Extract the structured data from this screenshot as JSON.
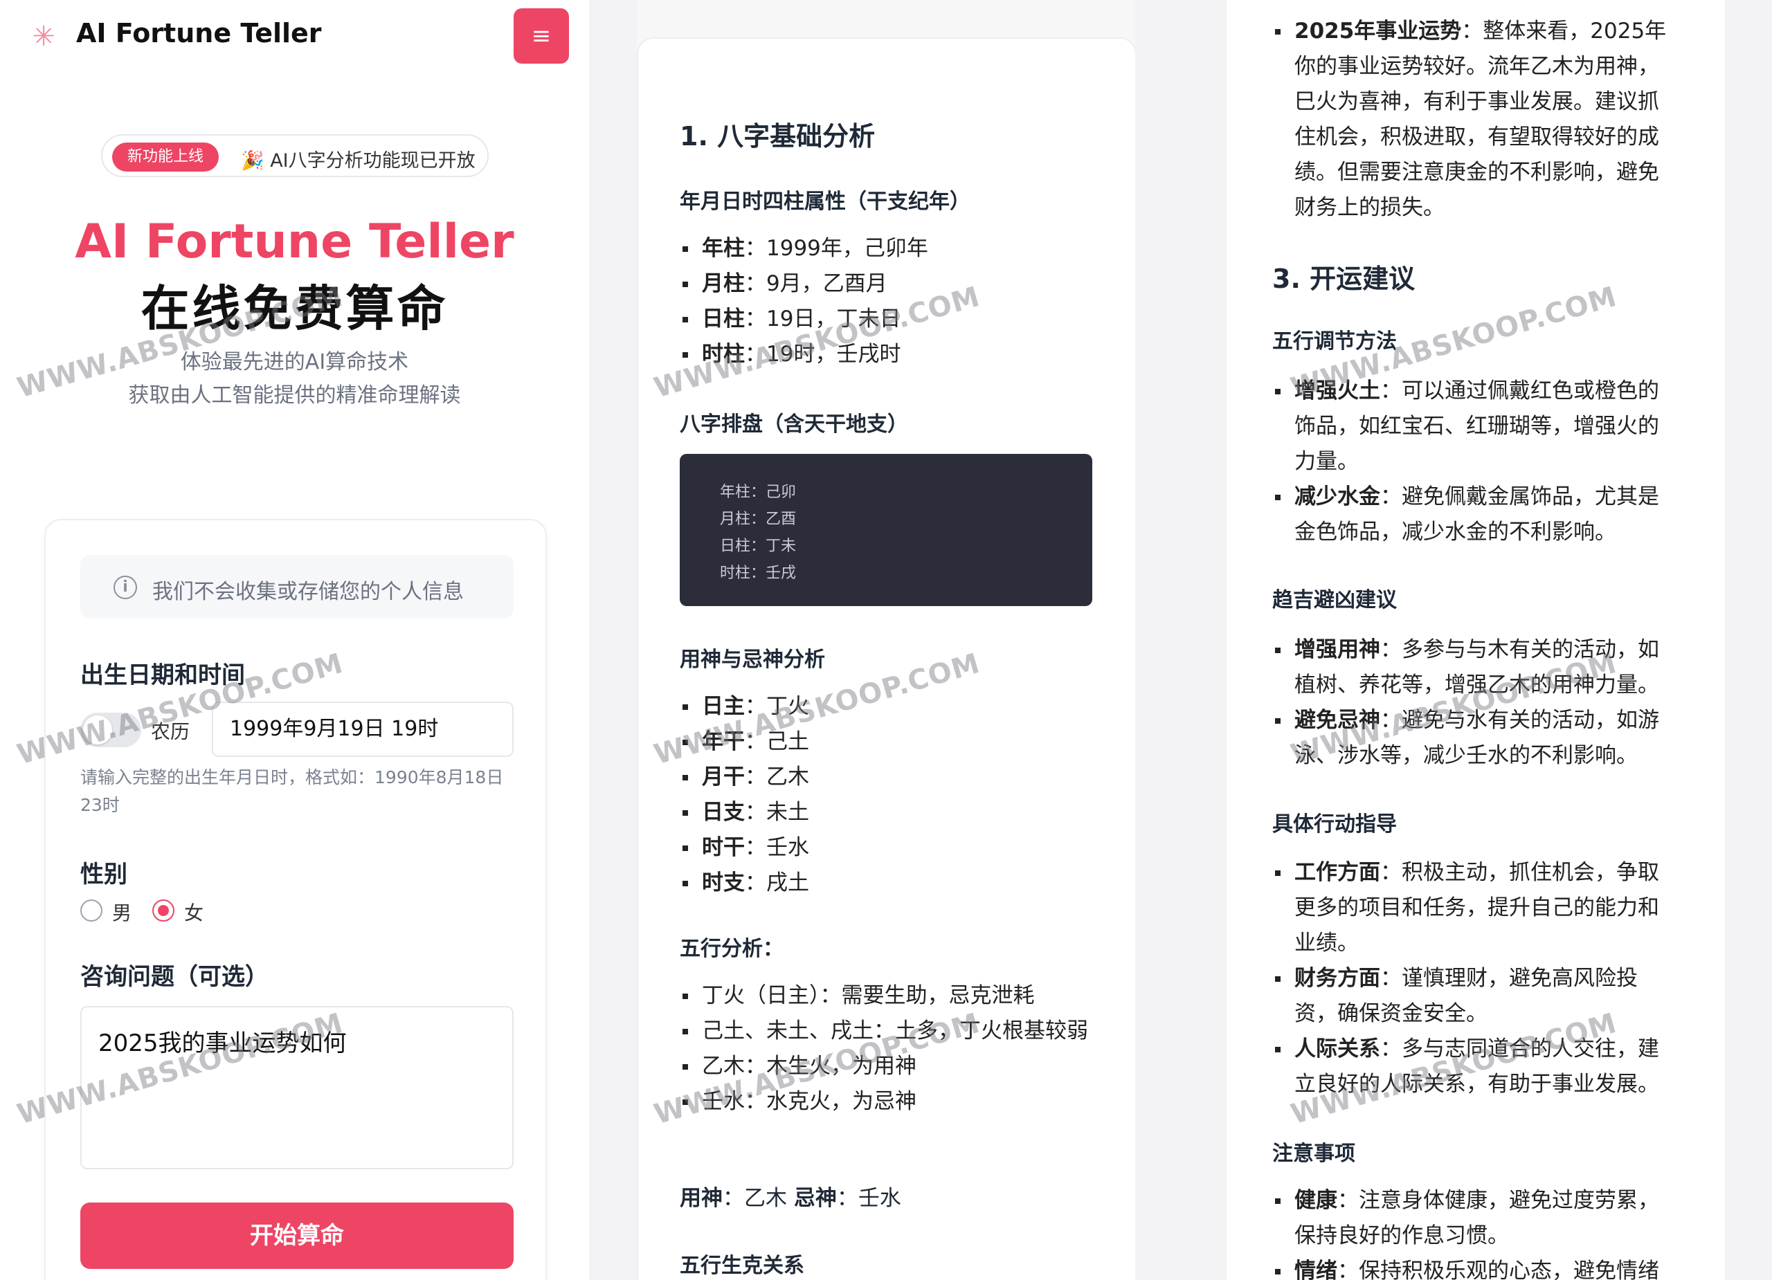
{
  "header": {
    "brand": "AI Fortune Teller",
    "menu_icon": "≡"
  },
  "announcement": {
    "badge": "新功能上线",
    "text": "🎉 AI八字分析功能现已开放"
  },
  "hero": {
    "title_en": "AI Fortune Teller",
    "title_cn": "在线免费算命",
    "subtitle_line1": "体验最先进的AI算命技术",
    "subtitle_line2": "获取由人工智能提供的精准命理解读"
  },
  "form": {
    "privacy_note": "我们不会收集或存储您的个人信息",
    "birth_label": "出生日期和时间",
    "lunar_label": "农历",
    "lunar_toggle_on": false,
    "birth_value": "1999年9月19日 19时",
    "birth_hint": "请输入完整的出生年月日时，格式如：1990年8月18日 23时",
    "gender_label": "性别",
    "gender_male": "男",
    "gender_female": "女",
    "gender_selected": "女",
    "question_label": "咨询问题（可选）",
    "question_value": "2025我的事业运势如何",
    "submit_label": "开始算命"
  },
  "result": {
    "sec1_title": "1. 八字基础分析",
    "pillars_title": "年月日时四柱属性（干支纪年）",
    "pillars": [
      {
        "k": "年柱",
        "v": "：1999年，己卯年"
      },
      {
        "k": "月柱",
        "v": "：9月，乙酉月"
      },
      {
        "k": "日柱",
        "v": "：19日，丁未日"
      },
      {
        "k": "时柱",
        "v": "：19时，壬戌时"
      }
    ],
    "paipan_title": "八字排盘（含天干地支）",
    "paipan_code": [
      "年柱：己卯",
      "月柱：乙酉",
      "日柱：丁未",
      "时柱：壬戌"
    ],
    "yongshen_title": "用神与忌神分析",
    "stems": [
      {
        "k": "日主",
        "v": "：丁火"
      },
      {
        "k": "年干",
        "v": "：己土"
      },
      {
        "k": "月干",
        "v": "：乙木"
      },
      {
        "k": "日支",
        "v": "：未土"
      },
      {
        "k": "时干",
        "v": "：壬水"
      },
      {
        "k": "时支",
        "v": "：戌土"
      }
    ],
    "wuxing_title": "五行分析：",
    "wuxing": [
      "丁火（日主）：需要生助，忌克泄耗",
      "己土、未土、戌土：土多，丁火根基较弱",
      "乙木：木生火，为用神",
      "壬水：水克火，为忌神"
    ],
    "yongshen_line_k1": "用神",
    "yongshen_line_v1": "：乙木 ",
    "yongshen_line_k2": "忌神",
    "yongshen_line_v2": "：壬水",
    "shengke_title": "五行生克关系",
    "career_k": "2025年事业运势",
    "career_v": "：整体来看，2025年你的事业运势较好。流年乙木为用神，巳火为喜神，有利于事业发展。建议抓住机会，积极进取，有望取得较好的成绩。但需要注意庚金的不利影响，避免财务上的损失。",
    "sec3_title": "3. 开运建议",
    "adjust_title": "五行调节方法",
    "adjust": [
      {
        "k": "增强火土",
        "v": "：可以通过佩戴红色或橙色的饰品，如红宝石、红珊瑚等，增强火的力量。"
      },
      {
        "k": "减少水金",
        "v": "：避免佩戴金属饰品，尤其是金色饰品，减少水金的不利影响。"
      }
    ],
    "luck_title": "趋吉避凶建议",
    "luck": [
      {
        "k": "增强用神",
        "v": "：多参与与木有关的活动，如植树、养花等，增强乙木的用神力量。"
      },
      {
        "k": "避免忌神",
        "v": "：避免与水有关的活动，如游泳、涉水等，减少壬水的不利影响。"
      }
    ],
    "action_title": "具体行动指导",
    "action": [
      {
        "k": "工作方面",
        "v": "：积极主动，抓住机会，争取更多的项目和任务，提升自己的能力和业绩。"
      },
      {
        "k": "财务方面",
        "v": "：谨慎理财，避免高风险投资，确保资金安全。"
      },
      {
        "k": "人际关系",
        "v": "：多与志同道合的人交往，建立良好的人际关系，有助于事业发展。"
      }
    ],
    "notes_title": "注意事项",
    "notes": [
      {
        "k": "健康",
        "v": "：注意身体健康，避免过度劳累，保持良好的作息习惯。"
      },
      {
        "k": "情绪",
        "v": "：保持积极乐观的心态，避免情绪"
      }
    ]
  },
  "watermark": "WWW.ABSKOOP.COM",
  "colors": {
    "accent": "#ee4564",
    "code_bg": "#2b2d3a"
  }
}
